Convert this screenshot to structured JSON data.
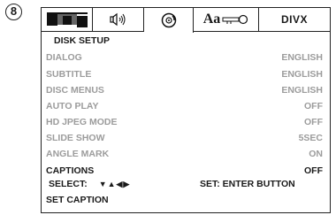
{
  "step_number": "8",
  "tabs": [
    {
      "name": "picture-icon"
    },
    {
      "name": "speaker-icon"
    },
    {
      "name": "disc-icon",
      "active": true
    },
    {
      "name": "language-lock-icon",
      "text": "Aa"
    },
    {
      "name": "divx-logo",
      "text": "DIVX"
    }
  ],
  "menu": {
    "title": "DISK SETUP",
    "items": [
      {
        "label": "DIALOG",
        "value": "ENGLISH"
      },
      {
        "label": "SUBTITLE",
        "value": "ENGLISH"
      },
      {
        "label": "DISC MENUS",
        "value": "ENGLISH"
      },
      {
        "label": "AUTO PLAY",
        "value": "OFF"
      },
      {
        "label": "HD JPEG MODE",
        "value": "OFF"
      },
      {
        "label": "SLIDE SHOW",
        "value": "5SEC"
      },
      {
        "label": "ANGLE MARK",
        "value": "ON"
      },
      {
        "label": "CAPTIONS",
        "value": "OFF"
      }
    ]
  },
  "footer": {
    "select_label": "SELECT:",
    "arrows": "▼▲◀▶",
    "set_label": "SET: ENTER BUTTON",
    "help_text": "SET CAPTION"
  },
  "colors": {
    "dim_text": "#9c9c9c",
    "active_text": "#1a1a1a"
  }
}
